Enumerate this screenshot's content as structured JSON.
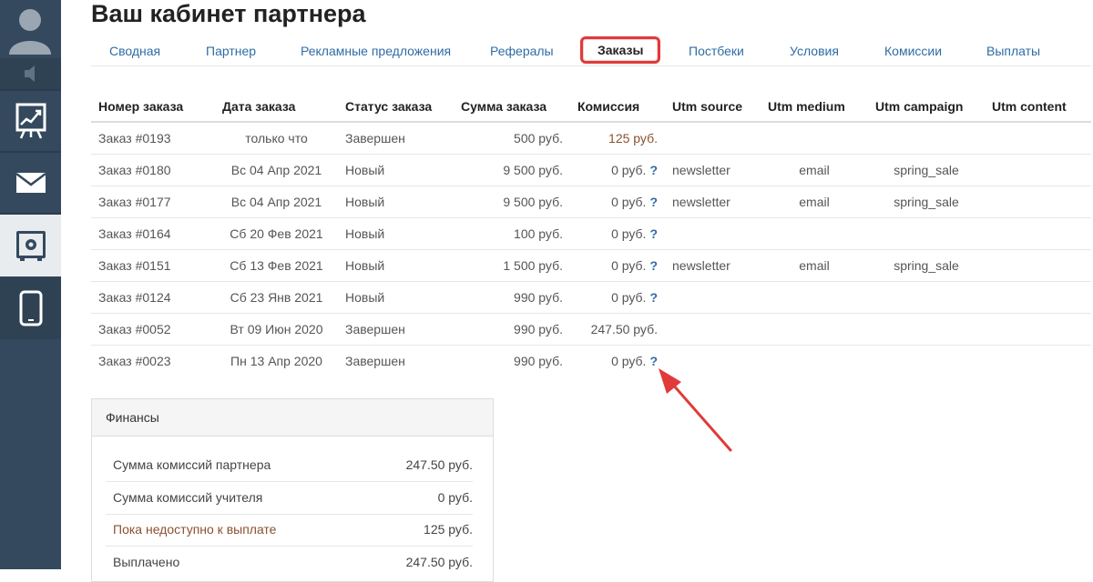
{
  "page": {
    "title": "Ваш кабинет партнера"
  },
  "tabs": [
    {
      "label": "Сводная"
    },
    {
      "label": "Партнер"
    },
    {
      "label": "Рекламные предложения"
    },
    {
      "label": "Рефералы"
    },
    {
      "label": "Заказы",
      "active": true
    },
    {
      "label": "Постбеки"
    },
    {
      "label": "Условия"
    },
    {
      "label": "Комиссии"
    },
    {
      "label": "Выплаты"
    }
  ],
  "table": {
    "headers": [
      "Номер заказа",
      "Дата заказа",
      "Статус заказа",
      "Сумма заказа",
      "Комиссия",
      "Utm source",
      "Utm medium",
      "Utm campaign",
      "Utm content"
    ],
    "rows": [
      {
        "order": "Заказ #0193",
        "date": "только что",
        "status": "Завершен",
        "sum": "500 руб.",
        "commission": "125 руб.",
        "help": "",
        "source": "",
        "medium": "",
        "campaign": "",
        "content": ""
      },
      {
        "order": "Заказ #0180",
        "date": "Вс 04 Апр 2021",
        "status": "Новый",
        "sum": "9 500 руб.",
        "commission": "0 руб.",
        "help": "?",
        "source": "newsletter",
        "medium": "email",
        "campaign": "spring_sale",
        "content": ""
      },
      {
        "order": "Заказ #0177",
        "date": "Вс 04 Апр 2021",
        "status": "Новый",
        "sum": "9 500 руб.",
        "commission": "0 руб.",
        "help": "?",
        "source": "newsletter",
        "medium": "email",
        "campaign": "spring_sale",
        "content": ""
      },
      {
        "order": "Заказ #0164",
        "date": "Сб 20 Фев 2021",
        "status": "Новый",
        "sum": "100 руб.",
        "commission": "0 руб.",
        "help": "?",
        "source": "",
        "medium": "",
        "campaign": "",
        "content": ""
      },
      {
        "order": "Заказ #0151",
        "date": "Сб 13 Фев 2021",
        "status": "Новый",
        "sum": "1 500 руб.",
        "commission": "0 руб.",
        "help": "?",
        "source": "newsletter",
        "medium": "email",
        "campaign": "spring_sale",
        "content": ""
      },
      {
        "order": "Заказ #0124",
        "date": "Сб 23 Янв 2021",
        "status": "Новый",
        "sum": "990 руб.",
        "commission": "0 руб.",
        "help": "?",
        "source": "",
        "medium": "",
        "campaign": "",
        "content": ""
      },
      {
        "order": "Заказ #0052",
        "date": "Вт 09 Июн 2020",
        "status": "Завершен",
        "sum": "990 руб.",
        "commission": "247.50 руб.",
        "help": "",
        "source": "",
        "medium": "",
        "campaign": "",
        "content": ""
      },
      {
        "order": "Заказ #0023",
        "date": "Пн 13 Апр 2020",
        "status": "Завершен",
        "sum": "990 руб.",
        "commission": "0 руб.",
        "help": "?",
        "source": "",
        "medium": "",
        "campaign": "",
        "content": ""
      }
    ]
  },
  "finance": {
    "title": "Финансы",
    "rows": [
      {
        "label": "Сумма комиссий партнера",
        "value": "247.50 руб."
      },
      {
        "label": "Сумма комиссий учителя",
        "value": "0 руб."
      },
      {
        "label": "Пока недоступно к выплате",
        "value": "125 руб.",
        "highlight": true
      },
      {
        "label": "Выплачено",
        "value": "247.50 руб."
      }
    ]
  },
  "sidebar": {
    "icons": [
      "user-avatar-icon",
      "sound-icon",
      "chart-board-icon",
      "mail-icon",
      "safe-icon",
      "phone-icon"
    ],
    "active": "safe-icon"
  },
  "colors": {
    "sidebar": "#34495e",
    "link": "#2f6ca5",
    "highlight_border": "#e03a3a",
    "arrow": "#e03a3a",
    "brown_text": "#8a5030"
  }
}
